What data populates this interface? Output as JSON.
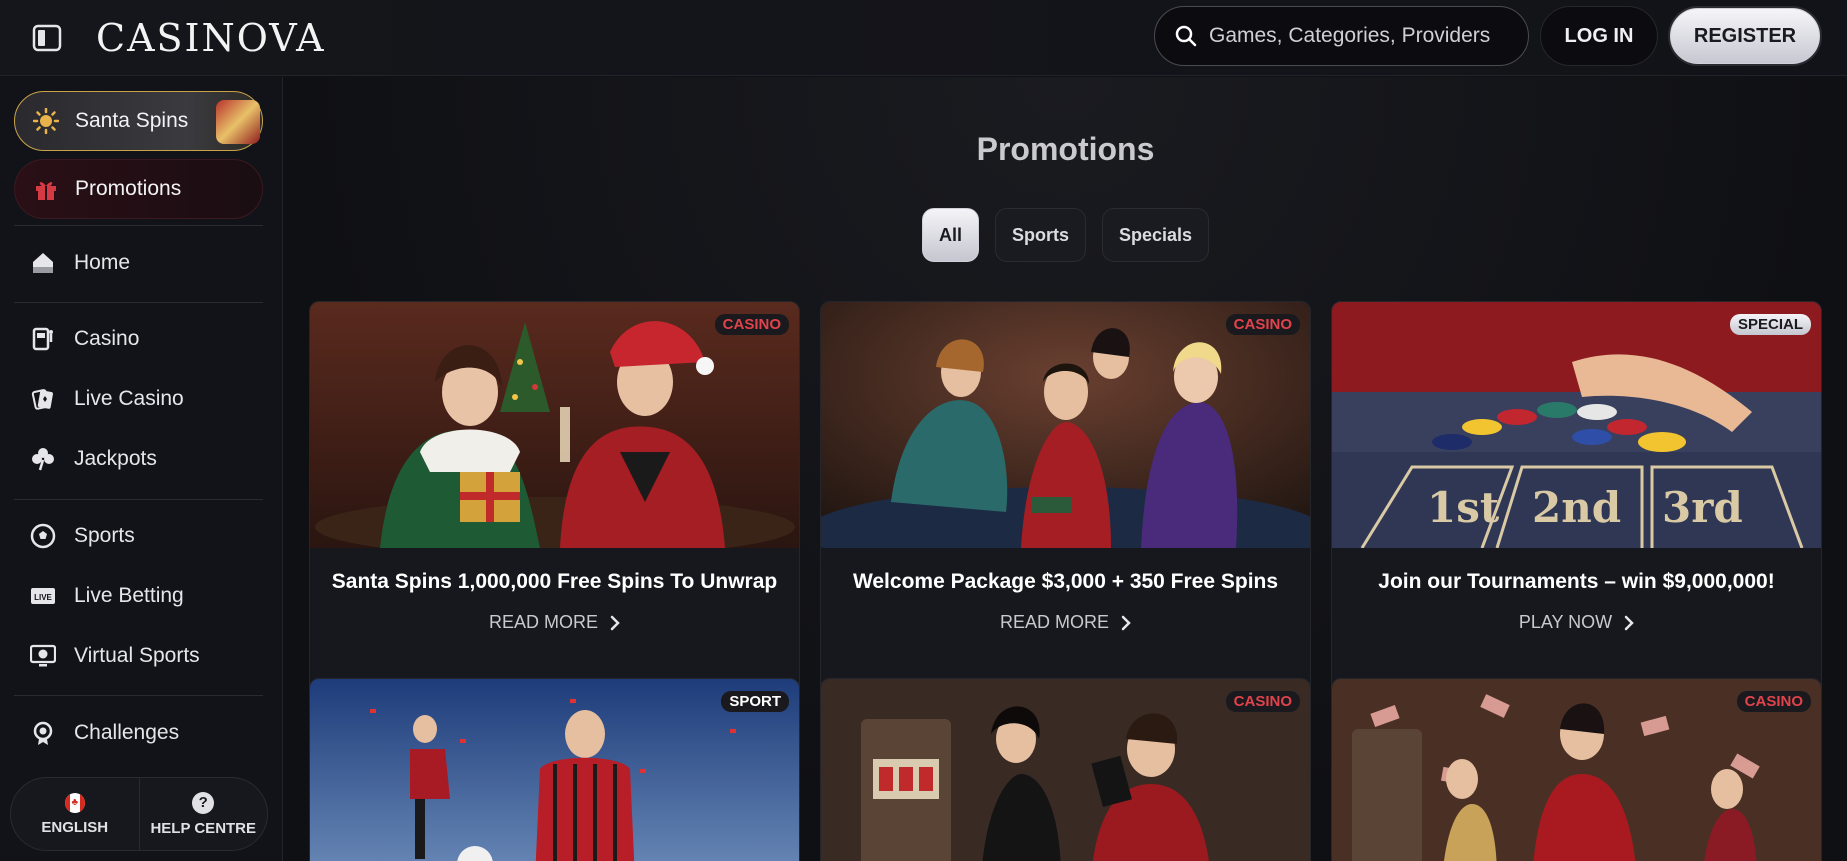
{
  "header": {
    "logo": "CASINOVA",
    "search_placeholder": "Games, Categories, Providers",
    "login_label": "LOG IN",
    "register_label": "REGISTER"
  },
  "sidebar": {
    "promos": [
      {
        "label": "Santa Spins",
        "icon": "sun-icon"
      },
      {
        "label": "Promotions",
        "icon": "gift-icon"
      }
    ],
    "items": [
      {
        "label": "Home",
        "icon": "home-icon"
      },
      {
        "label": "Casino",
        "icon": "slot-machine-icon"
      },
      {
        "label": "Live Casino",
        "icon": "cards-icon"
      },
      {
        "label": "Jackpots",
        "icon": "clover-icon"
      },
      {
        "label": "Sports",
        "icon": "soccer-ball-icon"
      },
      {
        "label": "Live Betting",
        "icon": "live-icon"
      },
      {
        "label": "Virtual Sports",
        "icon": "virtual-sports-icon"
      },
      {
        "label": "Challenges",
        "icon": "challenge-icon"
      }
    ],
    "footer": {
      "language_label": "ENGLISH",
      "help_label": "HELP CENTRE"
    }
  },
  "main": {
    "title": "Promotions",
    "filters": [
      "All",
      "Sports",
      "Specials"
    ],
    "active_filter": "All",
    "cards": [
      {
        "tag": "CASINO",
        "title": "Santa Spins 1,000,000 Free Spins To Unwrap",
        "link": "READ MORE"
      },
      {
        "tag": "CASINO",
        "title": "Welcome Package $3,000 + 350 Free Spins",
        "link": "READ MORE"
      },
      {
        "tag": "SPECIAL",
        "title": "Join our Tournaments – win $9,000,000!",
        "link": "PLAY NOW"
      },
      {
        "tag": "SPORT",
        "title": "",
        "link": ""
      },
      {
        "tag": "CASINO",
        "title": "",
        "link": ""
      },
      {
        "tag": "CASINO",
        "title": "",
        "link": ""
      }
    ],
    "tournament_places": [
      "1st",
      "2nd",
      "3rd"
    ]
  },
  "colors": {
    "accent_red": "#e0434b",
    "gold_border": "#c9a24a",
    "background": "#0f1014"
  }
}
